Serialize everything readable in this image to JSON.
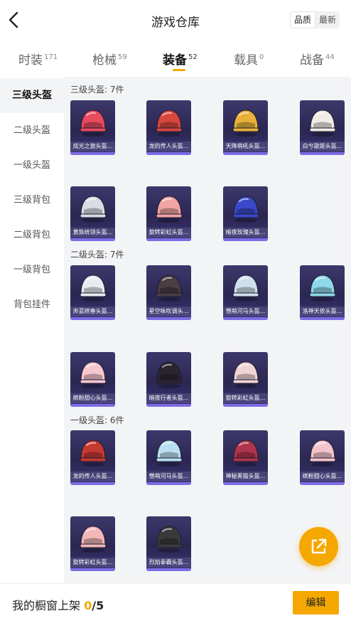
{
  "header": {
    "title": "游戏仓库",
    "sort_quality": "品质",
    "sort_newest": "最新"
  },
  "tabs": [
    {
      "label": "时装",
      "count": "171"
    },
    {
      "label": "枪械",
      "count": "59"
    },
    {
      "label": "装备",
      "count": "52"
    },
    {
      "label": "载具",
      "count": "0"
    },
    {
      "label": "战备",
      "count": "44"
    }
  ],
  "sidebar": [
    "三级头盔",
    "二级头盔",
    "一级头盔",
    "三级背包",
    "二级背包",
    "一级背包",
    "背包挂件"
  ],
  "sections": [
    {
      "title": "三级头盔: 7件",
      "items": [
        {
          "name": "炫光之旅头盔...",
          "color": "#e84a5f"
        },
        {
          "name": "龙的传人头盔...",
          "color": "#d9473f"
        },
        {
          "name": "天降萌吼头盔...",
          "color": "#e8b23a"
        },
        {
          "name": "白兮歌姬头盔...",
          "color": "#f1ece4"
        },
        {
          "name": "黄族统领头盔...",
          "color": "#d8dde3"
        },
        {
          "name": "旋转彩虹头盔...",
          "color": "#f2a3a3"
        },
        {
          "name": "暗夜玫瑰头盔...",
          "color": "#3b49c9"
        }
      ]
    },
    {
      "title": "二级头盔: 7件",
      "items": [
        {
          "name": "奔蓝缤春头盔...",
          "color": "#e7ecef"
        },
        {
          "name": "星空咏叹调头...",
          "color": "#4a3e42"
        },
        {
          "name": "憎萌河马头盔...",
          "color": "#cfe0ec"
        },
        {
          "name": "洛神天依头盔...",
          "color": "#8fd7ea"
        },
        {
          "name": "缤粉甜心头盔...",
          "color": "#f7c6cf"
        },
        {
          "name": "暗夜行者头盔...",
          "color": "#2a2430"
        },
        {
          "name": "旋转彩虹头盔...",
          "color": "#f0d4d4"
        }
      ]
    },
    {
      "title": "一级头盔: 6件",
      "items": [
        {
          "name": "龙的传人头盔...",
          "color": "#c43a30"
        },
        {
          "name": "憎萌河马头盔...",
          "color": "#b9dff0"
        },
        {
          "name": "神秘黑猫头盔...",
          "color": "#b0344c"
        },
        {
          "name": "缤粉甜心头盔...",
          "color": "#f4c4cc"
        },
        {
          "name": "旋转彩虹头盔...",
          "color": "#f3b6b6"
        },
        {
          "name": "烈焰拳霸头盔...",
          "color": "#3a3a3a"
        }
      ]
    }
  ],
  "bottom": {
    "text": "我的橱窗上架 ",
    "count": "0",
    "total": "/5",
    "edit_label": "编辑"
  }
}
